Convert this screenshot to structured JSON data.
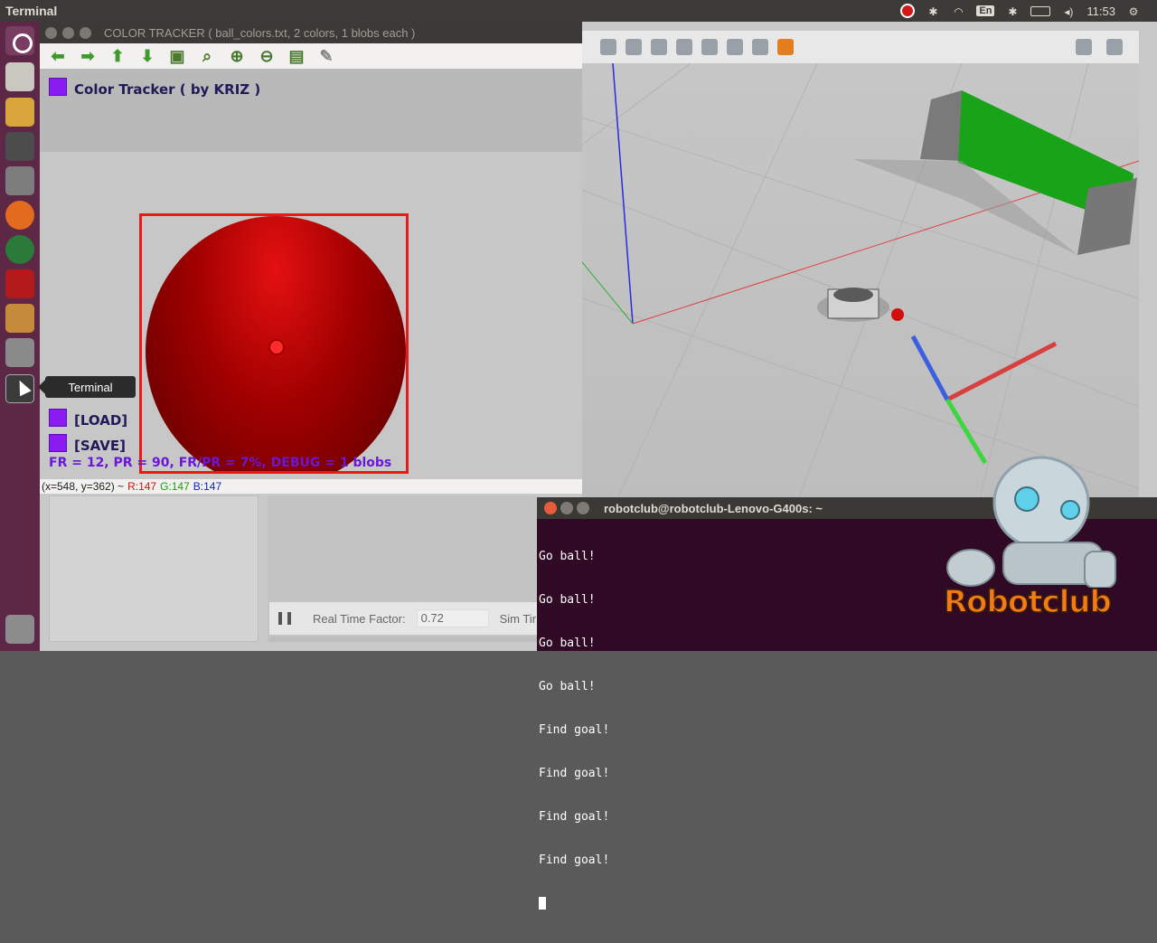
{
  "topbar": {
    "app_title": "Terminal",
    "lang": "En",
    "clock": "11:53"
  },
  "launcher": {
    "tooltip": "Terminal"
  },
  "tracker": {
    "title": "COLOR TRACKER ( ball_colors.txt, 2 colors, 1 blobs each )",
    "header_label": "Color Tracker ( by KRIZ )",
    "load_label": "[LOAD]",
    "save_label": "[SAVE]",
    "stats": "FR = 12, PR = 90, FR/PR = 7%, DEBUG = 1 blobs",
    "coords": "(x=548, y=362) ~",
    "r": "R:147",
    "g": "G:147",
    "b": "B:147",
    "toolbar_icons": [
      "arrow-left-icon",
      "arrow-right-icon",
      "arrow-up-icon",
      "arrow-down-icon",
      "image-icon",
      "zoom-fit-icon",
      "zoom-in-icon",
      "zoom-out-icon",
      "save-icon",
      "brush-icon"
    ],
    "swatch_color": "#8a1cf2",
    "bbox_color": "#e61a1a"
  },
  "gazebo": {
    "rtf_label": "Real Time Factor:",
    "rtf_value": "0.72",
    "sim_time_label": "Sim Tir"
  },
  "terminal": {
    "title": "robotclub@robotclub-Lenovo-G400s: ~",
    "lines": [
      "Go ball!",
      "Go ball!",
      "Go ball!",
      "Go ball!",
      "Find goal!",
      "Find goal!",
      "Find goal!",
      "Find goal!"
    ]
  },
  "logo": {
    "text": "Robotclub"
  }
}
